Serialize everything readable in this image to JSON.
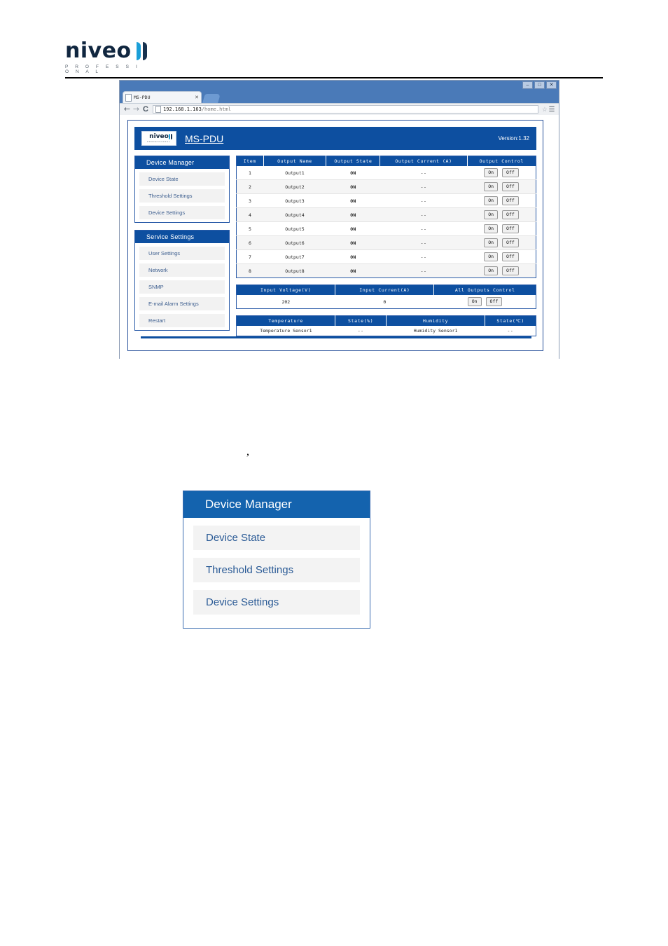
{
  "document": {
    "brand_logo_word": "niveo",
    "brand_logo_sub": "P R O F E S S I O N A L",
    "stray_mark": ","
  },
  "browser": {
    "window_buttons": [
      "–",
      "□",
      "✕"
    ],
    "tab": {
      "title": "MS-PDU",
      "close": "✕"
    },
    "nav": {
      "back": "←",
      "forward": "→",
      "reload": "C"
    },
    "omnibox": {
      "url_host": "192.168.1.163",
      "url_path": "/home.html",
      "star": "☆"
    },
    "menu": "☰"
  },
  "app": {
    "logo_word": "niveo",
    "logo_sub": "PROFESSIONAL",
    "title": "MS-PDU",
    "version": "Version:1.32"
  },
  "sidebar": {
    "panels": [
      {
        "title": "Device Manager",
        "items": [
          "Device State",
          "Threshold Settings",
          "Device Settings"
        ]
      },
      {
        "title": "Service Settings",
        "items": [
          "User Settings",
          "Network",
          "SNMP",
          "E-mail Alarm Settings",
          "Restart"
        ]
      }
    ]
  },
  "outputs_table": {
    "headers": [
      "Item",
      "Output Name",
      "Output State",
      "Output Current (A)",
      "Output Control"
    ],
    "rows": [
      {
        "item": "1",
        "name": "Output1",
        "state": "ON",
        "current": "--",
        "on": "On",
        "off": "Off"
      },
      {
        "item": "2",
        "name": "Output2",
        "state": "ON",
        "current": "--",
        "on": "On",
        "off": "Off"
      },
      {
        "item": "3",
        "name": "Output3",
        "state": "ON",
        "current": "--",
        "on": "On",
        "off": "Off"
      },
      {
        "item": "4",
        "name": "Output4",
        "state": "ON",
        "current": "--",
        "on": "On",
        "off": "Off"
      },
      {
        "item": "5",
        "name": "Output5",
        "state": "ON",
        "current": "--",
        "on": "On",
        "off": "Off"
      },
      {
        "item": "6",
        "name": "Output6",
        "state": "ON",
        "current": "--",
        "on": "On",
        "off": "Off"
      },
      {
        "item": "7",
        "name": "Output7",
        "state": "ON",
        "current": "--",
        "on": "On",
        "off": "Off"
      },
      {
        "item": "8",
        "name": "Output8",
        "state": "ON",
        "current": "--",
        "on": "On",
        "off": "Off"
      }
    ]
  },
  "input_table": {
    "headers": [
      "Input Voltage(V)",
      "Input Current(A)",
      "All Outputs Control"
    ],
    "row": {
      "voltage": "202",
      "current": "0",
      "on": "On",
      "off": "Off"
    }
  },
  "sensor_table": {
    "headers": [
      "Temperature",
      "State(%)",
      "Humidity",
      "State(℃)"
    ],
    "row": {
      "temperature": "Temperature Sensor1",
      "temp_state": "--",
      "humidity": "Humidity Sensor1",
      "hum_state": "--"
    }
  },
  "callout": {
    "title": "Device Manager",
    "items": [
      "Device State",
      "Threshold Settings",
      "Device Settings"
    ]
  },
  "colors": {
    "brand_blue": "#0d4fa0",
    "accent_cyan": "#1b9fd8",
    "link_blue": "#3e5f8f",
    "state_green": "#19a019"
  }
}
